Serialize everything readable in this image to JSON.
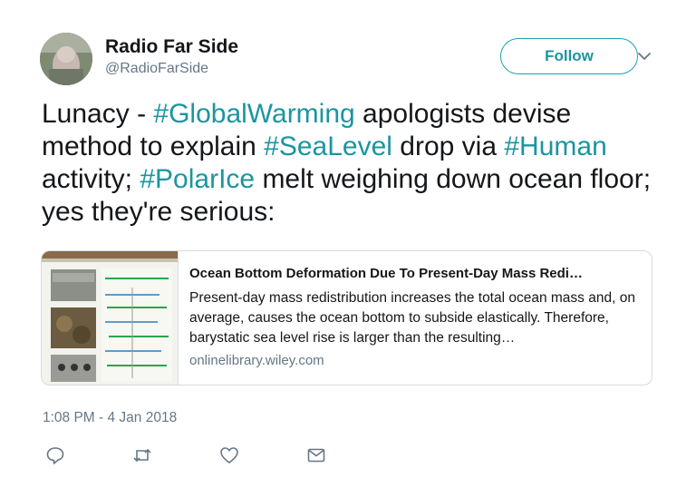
{
  "user": {
    "name": "Radio Far Side",
    "handle": "@RadioFarSide"
  },
  "follow_label": "Follow",
  "tweet": {
    "segments": [
      {
        "text": "Lunacy - ",
        "tag": false
      },
      {
        "text": "#GlobalWarming",
        "tag": true
      },
      {
        "text": " apologists devise method to explain ",
        "tag": false
      },
      {
        "text": "#SeaLevel",
        "tag": true
      },
      {
        "text": " drop via ",
        "tag": false
      },
      {
        "text": "#Human",
        "tag": true
      },
      {
        "text": " activity; ",
        "tag": false
      },
      {
        "text": "#PolarIce",
        "tag": true
      },
      {
        "text": " melt weighing down ocean floor; yes they're serious:",
        "tag": false
      }
    ]
  },
  "card": {
    "title": "Ocean Bottom Deformation Due To Present-Day Mass Redi…",
    "description": "Present-day mass redistribution increases the total ocean mass and, on average, causes the ocean bottom to subside elastically. Therefore, barystatic sea level rise is larger than the resulting…",
    "domain": "onlinelibrary.wiley.com"
  },
  "timestamp": "1:08 PM - 4 Jan 2018",
  "icons": {
    "reply": "reply-icon",
    "retweet": "retweet-icon",
    "like": "like-icon",
    "dm": "direct-message-icon",
    "more": "chevron-down-icon"
  },
  "colors": {
    "accent": "#1b95a0",
    "secondary_text": "#657786",
    "border": "#d6dbdf"
  }
}
